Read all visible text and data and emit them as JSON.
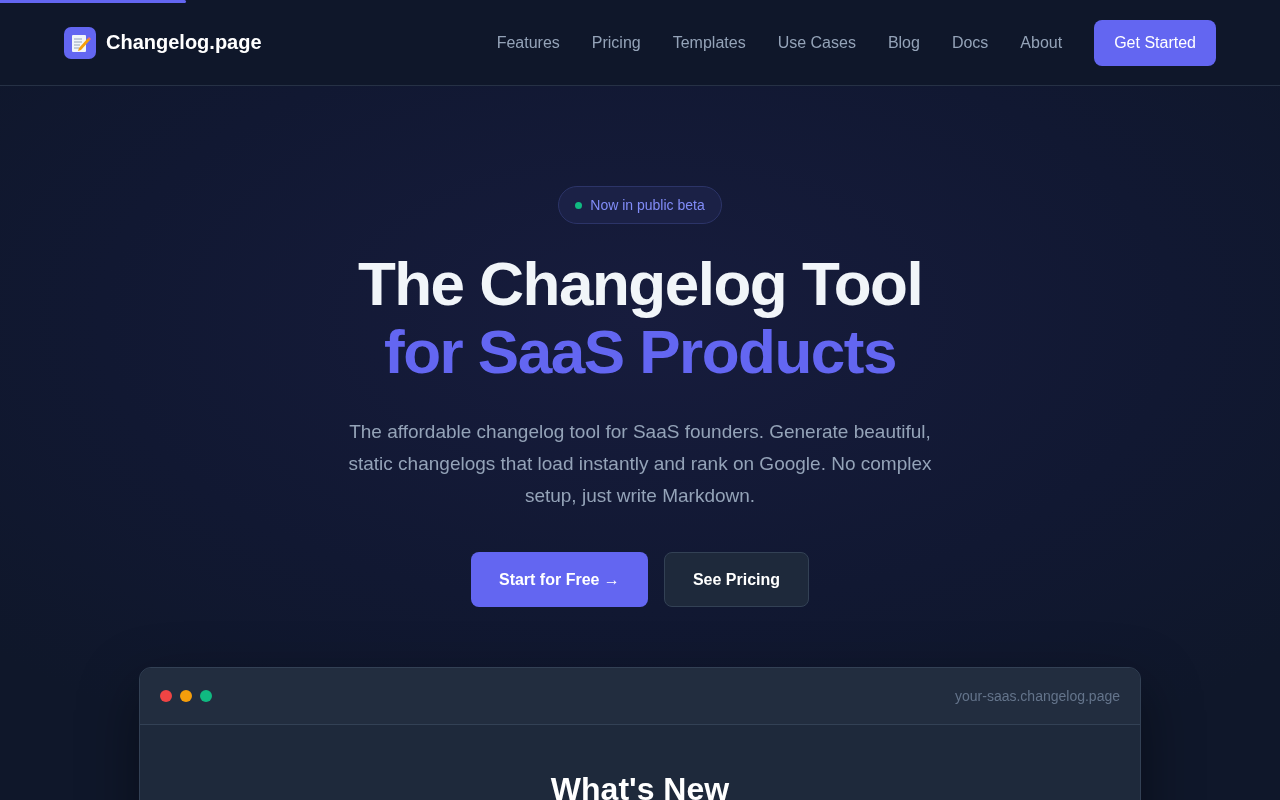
{
  "progress_bar": {
    "level": 0.145
  },
  "nav": {
    "brand": "Changelog.page",
    "links": [
      {
        "label": "Features"
      },
      {
        "label": "Pricing"
      },
      {
        "label": "Templates"
      },
      {
        "label": "Use Cases"
      },
      {
        "label": "Blog"
      },
      {
        "label": "Docs"
      },
      {
        "label": "About"
      }
    ],
    "cta": "Get Started"
  },
  "hero": {
    "badge": {
      "text": "Now in public beta",
      "color": "#10b981"
    },
    "title_line_1": "The Changelog Tool",
    "title_line_2": "for SaaS Products",
    "subtitle": "The affordable changelog tool for SaaS founders. Generate beautiful, static changelogs that load instantly and rank on Google. No complex setup, just write Markdown.",
    "buttons": [
      {
        "label": "Start for Free →",
        "kind": "primary"
      },
      {
        "label": "See Pricing",
        "kind": "secondary"
      }
    ]
  },
  "preview": {
    "dots": [
      {
        "color": "#ef4444"
      },
      {
        "color": "#f59e0b"
      },
      {
        "color": "#10b981"
      }
    ],
    "url": "your-saas.changelog.page",
    "heading": "What's New"
  }
}
